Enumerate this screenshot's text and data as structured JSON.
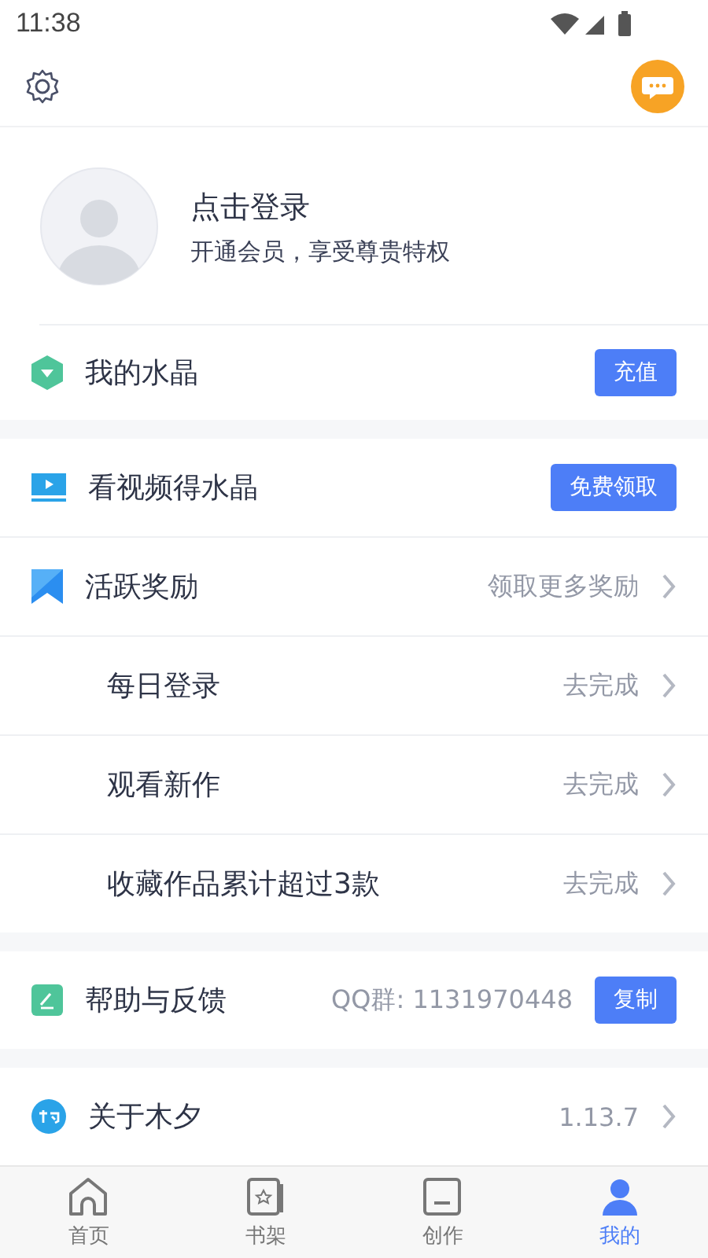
{
  "status_bar": {
    "time": "11:38"
  },
  "profile": {
    "title": "点击登录",
    "subtitle": "开通会员，享受尊贵特权"
  },
  "sections": [
    {
      "rows": [
        {
          "kind": "crystal",
          "label": "我的水晶",
          "button": "充值"
        }
      ]
    },
    {
      "rows": [
        {
          "kind": "video",
          "label": "看视频得水晶",
          "button": "免费领取"
        },
        {
          "kind": "reward",
          "label": "活跃奖励",
          "value": "领取更多奖励"
        },
        {
          "kind": "task",
          "label": "每日登录",
          "value": "去完成"
        },
        {
          "kind": "task",
          "label": "观看新作",
          "value": "去完成"
        },
        {
          "kind": "task",
          "label": "收藏作品累计超过3款",
          "value": "去完成"
        }
      ]
    },
    {
      "rows": [
        {
          "kind": "help",
          "label": "帮助与反馈",
          "value": "QQ群: 1131970448",
          "button": "复制"
        }
      ]
    },
    {
      "rows": [
        {
          "kind": "about",
          "label": "关于木夕",
          "value": "1.13.7"
        }
      ]
    }
  ],
  "tabs": [
    {
      "kind": "home",
      "label": "首页",
      "selected": false
    },
    {
      "kind": "shelf",
      "label": "书架",
      "selected": false
    },
    {
      "kind": "create",
      "label": "创作",
      "selected": false
    },
    {
      "kind": "me",
      "label": "我的",
      "selected": true
    }
  ]
}
